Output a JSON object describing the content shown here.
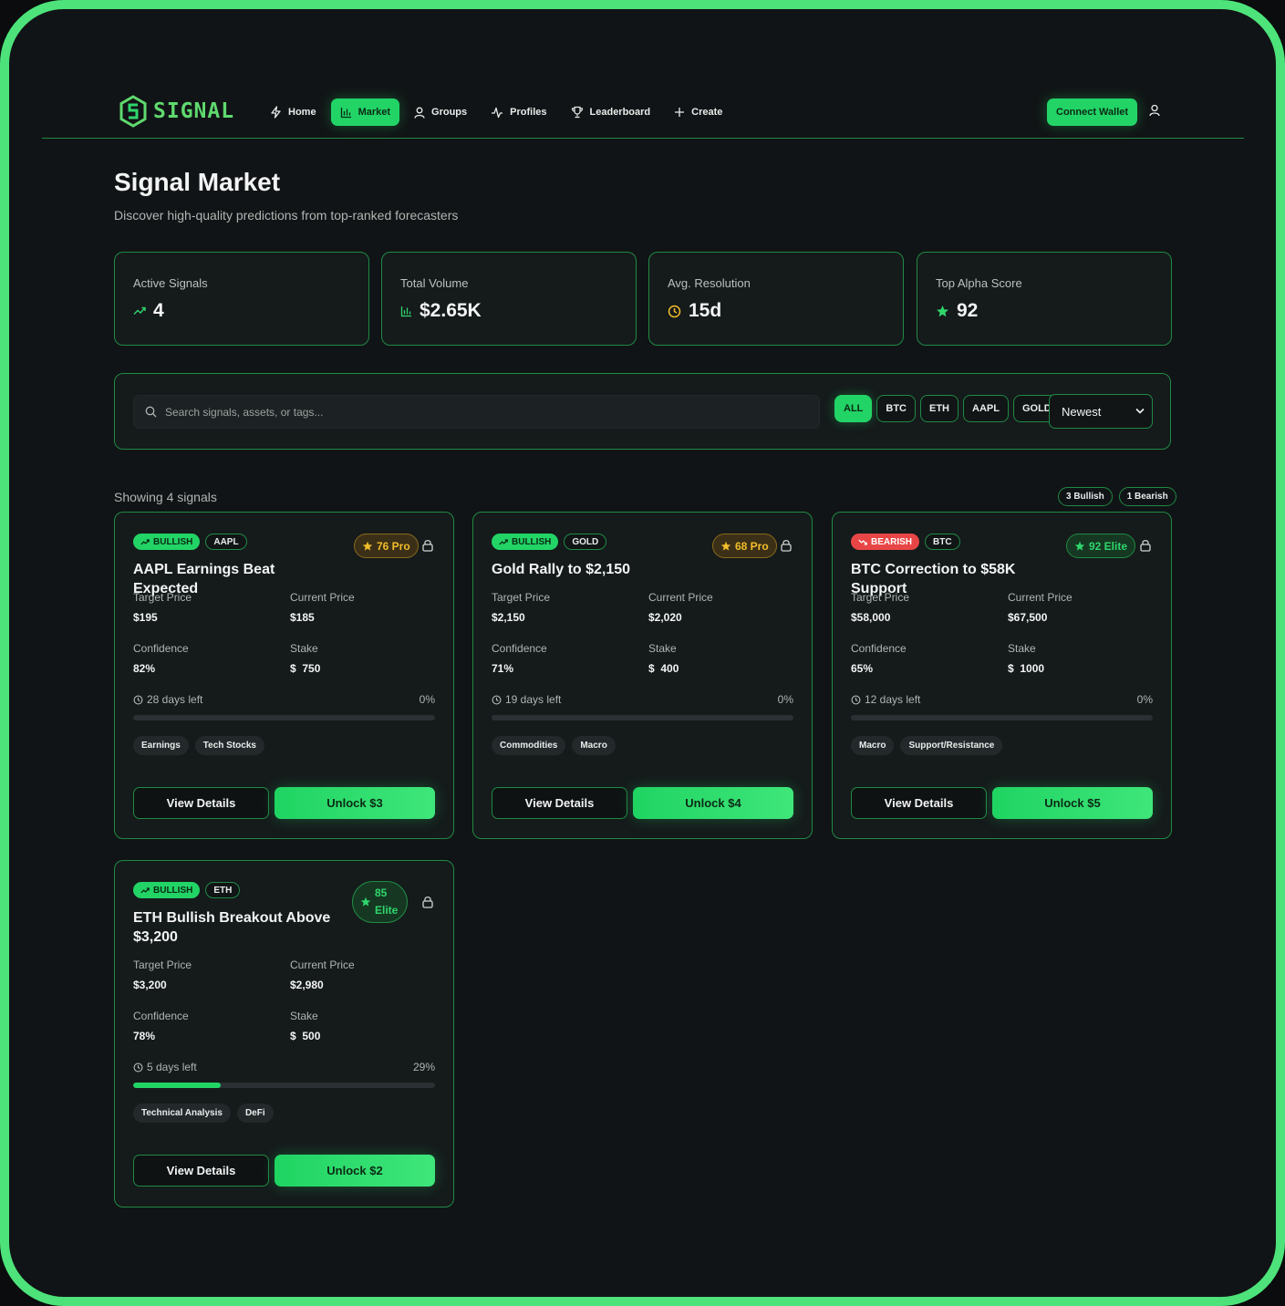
{
  "app": {
    "logo_text": "SIGNAL"
  },
  "nav": {
    "items": [
      {
        "label": "Home",
        "icon": "bolt-icon"
      },
      {
        "label": "Market",
        "icon": "bar-chart-icon",
        "active": true
      },
      {
        "label": "Groups",
        "icon": "user-icon"
      },
      {
        "label": "Profiles",
        "icon": "activity-icon"
      },
      {
        "label": "Leaderboard",
        "icon": "trophy-icon"
      },
      {
        "label": "Create",
        "icon": "plus-icon"
      }
    ],
    "connect_label": "Connect Wallet"
  },
  "header": {
    "title": "Signal Market",
    "subtitle": "Discover high-quality predictions from top-ranked forecasters"
  },
  "stats": [
    {
      "label": "Active Signals",
      "value": "4",
      "icon": "trending-up-icon"
    },
    {
      "label": "Total Volume",
      "value": "$2.65K",
      "icon": "bar-chart-icon"
    },
    {
      "label": "Avg. Resolution",
      "value": "15d",
      "icon": "clock-icon"
    },
    {
      "label": "Top Alpha Score",
      "value": "92",
      "icon": "star-icon"
    }
  ],
  "filter": {
    "search_placeholder": "Search signals, assets, or tags...",
    "chips": [
      "ALL",
      "BTC",
      "ETH",
      "AAPL",
      "GOLD"
    ],
    "active_chip": "ALL",
    "sort_value": "Newest"
  },
  "summary": {
    "showing": "Showing 4 signals",
    "bullish": "3 Bullish",
    "bearish": "1 Bearish"
  },
  "labels": {
    "target": "Target Price",
    "current": "Current Price",
    "confidence": "Confidence",
    "stake": "Stake",
    "view": "View Details"
  },
  "signals": [
    {
      "direction": "BULLISH",
      "asset": "AAPL",
      "title": "AAPL Earnings Beat Expected",
      "score": "76 Pro",
      "target": "$195",
      "current": "$185",
      "confidence": "82%",
      "stake": "750",
      "days": "28 days left",
      "progress_label": "0%",
      "progress": 0,
      "tags": [
        "Earnings",
        "Tech Stocks"
      ],
      "unlock": "Unlock $3"
    },
    {
      "direction": "BULLISH",
      "asset": "GOLD",
      "title": "Gold Rally to $2,150",
      "score": "68 Pro",
      "target": "$2,150",
      "current": "$2,020",
      "confidence": "71%",
      "stake": "400",
      "days": "19 days left",
      "progress_label": "0%",
      "progress": 0,
      "tags": [
        "Commodities",
        "Macro"
      ],
      "unlock": "Unlock $4"
    },
    {
      "direction": "BEARISH",
      "asset": "BTC",
      "title": "BTC Correction to $58K Support",
      "score": "92 Elite",
      "target": "$58,000",
      "current": "$67,500",
      "confidence": "65%",
      "stake": "1000",
      "days": "12 days left",
      "progress_label": "0%",
      "progress": 0,
      "tags": [
        "Macro",
        "Support/Resistance"
      ],
      "unlock": "Unlock $5"
    },
    {
      "direction": "BULLISH",
      "asset": "ETH",
      "title": "ETH Bullish Breakout Above $3,200",
      "score_num": "85",
      "score_tier": "Elite",
      "target": "$3,200",
      "current": "$2,980",
      "confidence": "78%",
      "stake": "500",
      "days": "5 days left",
      "progress_label": "29%",
      "progress": 0.29,
      "tags": [
        "Technical Analysis",
        "DeFi"
      ],
      "unlock": "Unlock $2"
    }
  ]
}
